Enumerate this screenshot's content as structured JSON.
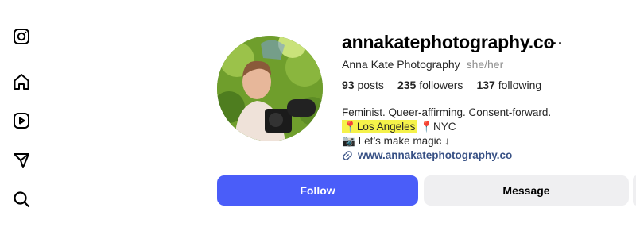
{
  "profile": {
    "username": "annakatephotography.co",
    "more_label": "···",
    "full_name": "Anna Kate Photography",
    "pronouns": "she/her",
    "stats": {
      "posts_count": "93",
      "posts_label": "posts",
      "followers_count": "235",
      "followers_label": "followers",
      "following_count": "137",
      "following_label": "following"
    },
    "bio": {
      "line1": "Feminist. Queer-affirming. Consent-forward.",
      "pin1": "📍",
      "location_highlighted": "Los Angeles",
      "pin2": "📍",
      "location2": "NYC",
      "camera_emoji": "📷",
      "line3": "Let’s make magic ↓"
    },
    "website": "www.annakatephotography.co"
  },
  "buttons": {
    "follow_label": "Follow",
    "message_label": "Message"
  },
  "sidebar": {
    "items": [
      {
        "icon": "instagram-icon"
      },
      {
        "icon": "home-icon"
      },
      {
        "icon": "reels-icon"
      },
      {
        "icon": "send-icon"
      },
      {
        "icon": "search-icon"
      }
    ]
  },
  "colors": {
    "follow_button": "#4a5df9",
    "message_button": "#efeff1",
    "link": "#385185",
    "highlight": "#f5f24a"
  }
}
